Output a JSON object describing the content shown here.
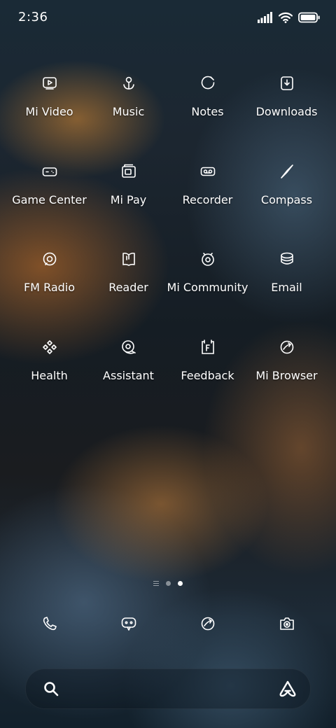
{
  "status_bar": {
    "time": "2:36",
    "icons": [
      "cellular-signal-icon",
      "wifi-icon",
      "battery-icon"
    ]
  },
  "apps": [
    {
      "label": "Mi Video",
      "icon": "video-icon"
    },
    {
      "label": "Music",
      "icon": "music-icon"
    },
    {
      "label": "Notes",
      "icon": "notes-icon"
    },
    {
      "label": "Downloads",
      "icon": "downloads-icon"
    },
    {
      "label": "Game Center",
      "icon": "gamepad-icon"
    },
    {
      "label": "Mi Pay",
      "icon": "wallet-icon"
    },
    {
      "label": "Recorder",
      "icon": "recorder-icon"
    },
    {
      "label": "Compass",
      "icon": "compass-icon"
    },
    {
      "label": "FM Radio",
      "icon": "radio-icon"
    },
    {
      "label": "Reader",
      "icon": "book-icon"
    },
    {
      "label": "Mi Community",
      "icon": "community-icon"
    },
    {
      "label": "Email",
      "icon": "email-icon"
    },
    {
      "label": "Health",
      "icon": "health-icon"
    },
    {
      "label": "Assistant",
      "icon": "assistant-icon"
    },
    {
      "label": "Feedback",
      "icon": "feedback-icon"
    },
    {
      "label": "Mi Browser",
      "icon": "browser-icon"
    }
  ],
  "page_indicator": {
    "pages": 2,
    "current": 2
  },
  "dock": [
    {
      "icon": "phone-icon"
    },
    {
      "icon": "messages-icon"
    },
    {
      "icon": "browser-icon"
    },
    {
      "icon": "camera-icon"
    }
  ],
  "search_bar": {
    "search_icon": "search-icon",
    "assistant_icon": "assistant-a-icon"
  }
}
